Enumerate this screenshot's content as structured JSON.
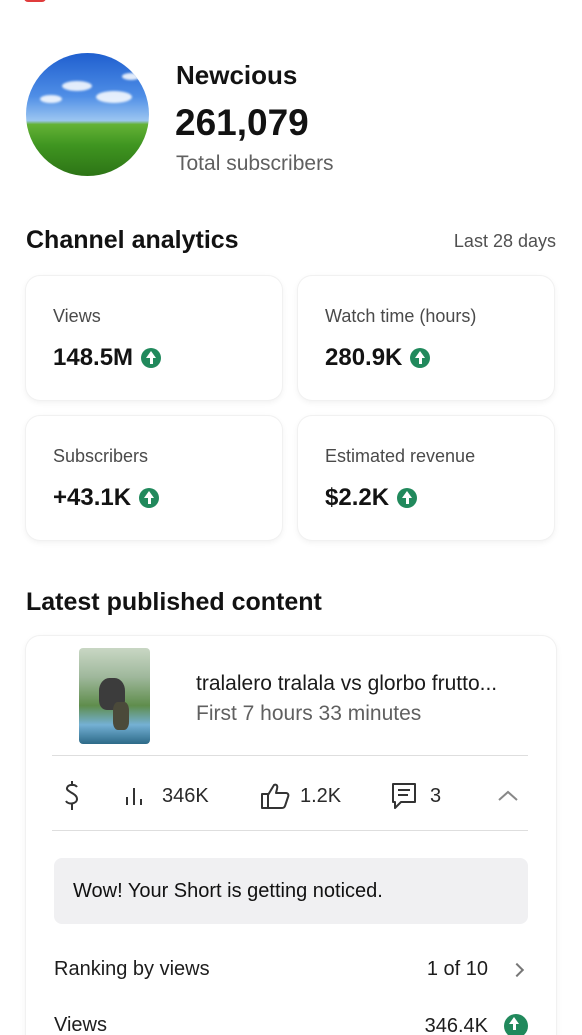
{
  "channel": {
    "name": "Newcious",
    "subscriber_count": "261,079",
    "subscriber_label": "Total subscribers"
  },
  "analytics": {
    "title": "Channel analytics",
    "range": "Last 28 days",
    "cards": [
      {
        "label": "Views",
        "value": "148.5M",
        "trend": "up"
      },
      {
        "label": "Watch time (hours)",
        "value": "280.9K",
        "trend": "up"
      },
      {
        "label": "Subscribers",
        "value": "+43.1K",
        "trend": "up"
      },
      {
        "label": "Estimated revenue",
        "value": "$2.2K",
        "trend": "up"
      }
    ]
  },
  "latest": {
    "title": "Latest published content",
    "video_title": "tralalero tralala vs glorbo frutto...",
    "video_subtitle": "First 7 hours 33 minutes",
    "stats": {
      "views": "346K",
      "likes": "1.2K",
      "comments": "3"
    },
    "notice": "Wow! Your Short is getting noticed.",
    "ranking_label": "Ranking by views",
    "ranking_value": "1 of 10",
    "views_label": "Views",
    "views_value": "346.4K"
  },
  "colors": {
    "trend_up": "#21895c",
    "brand_red": "#e03c3c"
  }
}
